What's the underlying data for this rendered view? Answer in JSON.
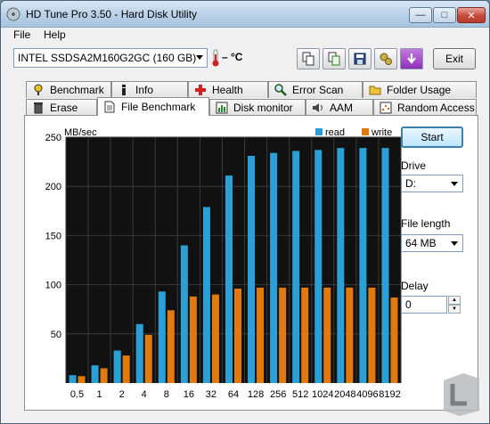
{
  "window": {
    "title": "HD Tune Pro 3.50 - Hard Disk Utility",
    "controls": {
      "minimize": "—",
      "maximize": "□",
      "close": "✕"
    }
  },
  "menu": {
    "file": "File",
    "help": "Help"
  },
  "toolbar": {
    "drive": "INTEL SSDSA2M160G2GC (160 GB)",
    "temperature": "– °C",
    "buttons": [
      "copy-icon",
      "save-copy-icon",
      "disk-save-icon",
      "options-icon",
      "download-icon"
    ],
    "exit": "Exit"
  },
  "tabs": {
    "row1": [
      "Benchmark",
      "Info",
      "Health",
      "Error Scan",
      "Folder Usage"
    ],
    "row2": [
      "Erase",
      "File Benchmark",
      "Disk monitor",
      "AAM",
      "Random Access"
    ],
    "active": "File Benchmark"
  },
  "side": {
    "start": "Start",
    "drive_label": "Drive",
    "drive_value": "D:",
    "file_length_label": "File length",
    "file_length_value": "64 MB",
    "delay_label": "Delay",
    "delay_value": "0"
  },
  "chart_data": {
    "type": "bar",
    "ylabel": "MB/sec",
    "ylim": [
      0,
      250
    ],
    "yticks": [
      50,
      100,
      150,
      200,
      250
    ],
    "categories": [
      "0.5",
      "1",
      "2",
      "4",
      "8",
      "16",
      "32",
      "64",
      "128",
      "256",
      "512",
      "1024",
      "2048",
      "4096",
      "8192"
    ],
    "series": [
      {
        "name": "read",
        "color": "#2aa0d6",
        "values": [
          8,
          18,
          33,
          60,
          93,
          140,
          179,
          211,
          231,
          234,
          236,
          237,
          239,
          239,
          239
        ]
      },
      {
        "name": "write",
        "color": "#e07a10",
        "values": [
          7,
          15,
          28,
          49,
          74,
          88,
          90,
          96,
          97,
          97,
          97,
          97,
          97,
          97,
          87
        ]
      }
    ],
    "grid": true,
    "legend": "top-right",
    "background": "#111111"
  },
  "colors": {
    "accent": "#3c7fb1",
    "chart_bg": "#111111"
  }
}
